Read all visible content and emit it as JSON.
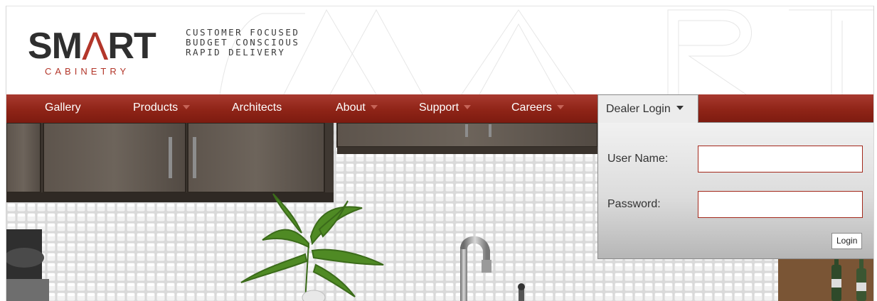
{
  "logo": {
    "word_left": "SM",
    "word_mid": "Λ",
    "word_right": "RT",
    "subtitle": "CABINETRY",
    "accent_color": "#b3362a"
  },
  "tagline": [
    "CUSTOMER FOCUSED",
    "BUDGET CONSCIOUS",
    "RAPID DELIVERY"
  ],
  "nav": {
    "bar_color": "#8f2417",
    "items": [
      {
        "label": "Gallery",
        "dropdown": false
      },
      {
        "label": "Products",
        "dropdown": true
      },
      {
        "label": "Architects",
        "dropdown": false
      },
      {
        "label": "About",
        "dropdown": true
      },
      {
        "label": "Support",
        "dropdown": true
      },
      {
        "label": "Careers",
        "dropdown": true
      }
    ]
  },
  "dealer_login": {
    "tab_label": "Dealer Login",
    "username_label": "User Name:",
    "username_value": "",
    "password_label": "Password:",
    "password_value": "",
    "login_button": "Login"
  }
}
